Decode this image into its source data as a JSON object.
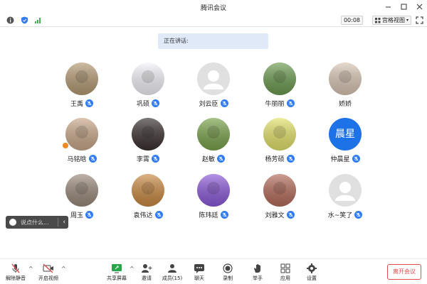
{
  "window": {
    "title": "腾讯会议"
  },
  "top_toolbar": {
    "timer": "00:08",
    "view_label": "宫格视图"
  },
  "speaking": {
    "label": "正在讲话:"
  },
  "participants": [
    {
      "name": "王禹",
      "avatar_color": "#b59a74",
      "avatar_type": "photo",
      "muted": true
    },
    {
      "name": "巩硕",
      "avatar_color": "#f4f2f8",
      "avatar_type": "photo",
      "muted": true
    },
    {
      "name": "刘云臣",
      "avatar_color": "#e0e0e0",
      "avatar_type": "default",
      "muted": true
    },
    {
      "name": "牛丽丽",
      "avatar_color": "#6b9a4f",
      "avatar_type": "photo",
      "muted": true
    },
    {
      "name": "娇娇",
      "avatar_color": "#d9c6b4",
      "avatar_type": "photo",
      "muted": false
    },
    {
      "name": "马铭晗",
      "avatar_color": "#c9a88a",
      "avatar_type": "photo",
      "muted": true,
      "badge": true
    },
    {
      "name": "李霄",
      "avatar_color": "#3b3030",
      "avatar_type": "photo",
      "muted": true
    },
    {
      "name": "赵敏",
      "avatar_color": "#7aa24b",
      "avatar_type": "photo",
      "muted": true
    },
    {
      "name": "杨芳硕",
      "avatar_color": "#e3e26a",
      "avatar_type": "photo",
      "muted": true
    },
    {
      "name": "仲晨星",
      "avatar_color": "#1e72e8",
      "avatar_type": "text",
      "avatar_text": "晨星",
      "muted": true
    },
    {
      "name": "周玉",
      "avatar_color": "#9a8a7c",
      "avatar_type": "photo",
      "muted": true
    },
    {
      "name": "袁伟达",
      "avatar_color": "#c98a43",
      "avatar_type": "photo",
      "muted": true
    },
    {
      "name": "陈玮廷",
      "avatar_color": "#8b5ad8",
      "avatar_type": "photo",
      "muted": true
    },
    {
      "name": "刘雅文",
      "avatar_color": "#b46b5a",
      "avatar_type": "photo",
      "muted": true
    },
    {
      "name": "水~笑了",
      "avatar_color": "#e0e0e0",
      "avatar_type": "default",
      "muted": true
    }
  ],
  "chat": {
    "placeholder": "说点什么..."
  },
  "bottom_toolbar": {
    "unmute": "解除静音",
    "start_video": "开启视频",
    "share_screen": "共享屏幕",
    "invite": "邀请",
    "members": "成员(15)",
    "chat": "聊天",
    "record": "录制",
    "raise_hand": "举手",
    "apps": "应用",
    "settings": "设置",
    "leave": "离开会议"
  },
  "colors": {
    "accent": "#2f7cf6",
    "leave": "#e34d4d",
    "banner": "#dfe9f8"
  }
}
